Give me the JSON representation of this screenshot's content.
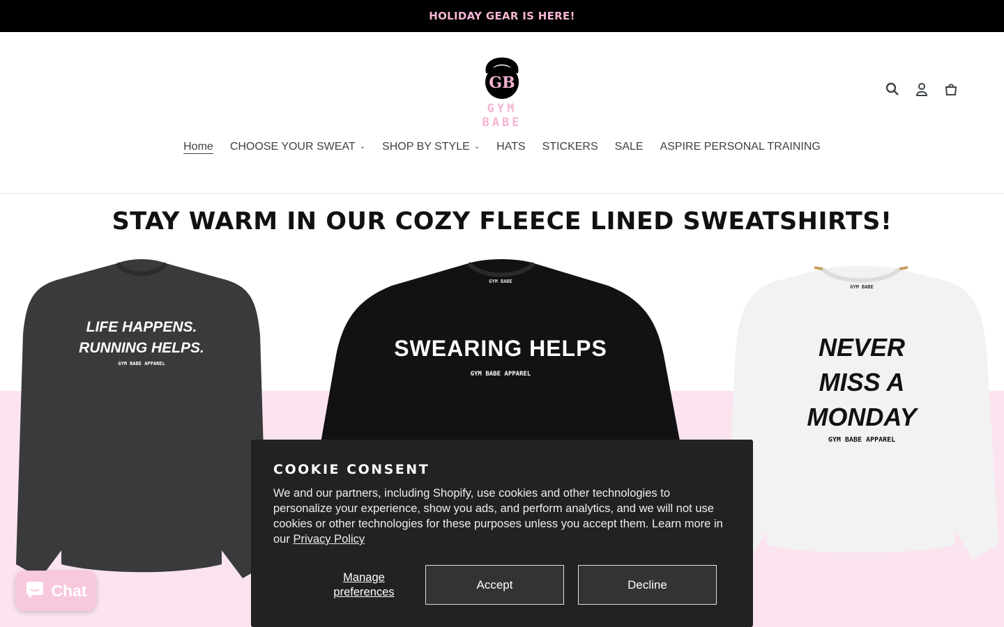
{
  "announcement": {
    "text": "HOLIDAY GEAR IS HERE!"
  },
  "header": {
    "logo_monogram": "GB",
    "logo_text": "GYM BABE",
    "icons": [
      "search-icon",
      "account-icon",
      "cart-icon"
    ]
  },
  "nav": {
    "items": [
      {
        "label": "Home",
        "active": true,
        "dropdown": false
      },
      {
        "label": "CHOOSE YOUR SWEAT",
        "dropdown": true
      },
      {
        "label": "SHOP BY STYLE",
        "dropdown": true
      },
      {
        "label": "HATS",
        "dropdown": false
      },
      {
        "label": "STICKERS",
        "dropdown": false
      },
      {
        "label": "SALE",
        "dropdown": false
      },
      {
        "label": "ASPIRE PERSONAL TRAINING",
        "dropdown": false
      }
    ]
  },
  "hero": {
    "title": "STAY WARM IN OUR COZY FLEECE LINED SWEATSHIRTS!",
    "shirts": [
      {
        "line1": "LIFE HAPPENS.",
        "line2": "RUNNING HELPS.",
        "brand": "GYM BABE APPAREL",
        "color": "#3a3a3c"
      },
      {
        "line1": "SWEARING HELPS",
        "brand": "GYM BABE APPAREL",
        "collar_brand": "GYM BABE",
        "color": "#121214"
      },
      {
        "line1": "NEVER",
        "line2": "MISS A",
        "line3": "MONDAY",
        "brand": "GYM BABE APPAREL",
        "collar_brand": "GYM BABE",
        "color": "#f2f2f2"
      }
    ]
  },
  "cookie": {
    "title": "COOKIE CONSENT",
    "body": "We and our partners, including Shopify, use cookies and other technologies to personalize your experience, show you ads, and perform analytics, and we will not use cookies or other technologies for these purposes unless you accept them. Learn more in our ",
    "link": "Privacy Policy",
    "manage_line1": "Manage",
    "manage_line2": "preferences",
    "accept": "Accept",
    "decline": "Decline"
  },
  "chat": {
    "label": "Chat"
  },
  "colors": {
    "accent_pink": "#f5b5d4",
    "pink_band": "#fbe4f0",
    "banner_dark": "#222222"
  }
}
